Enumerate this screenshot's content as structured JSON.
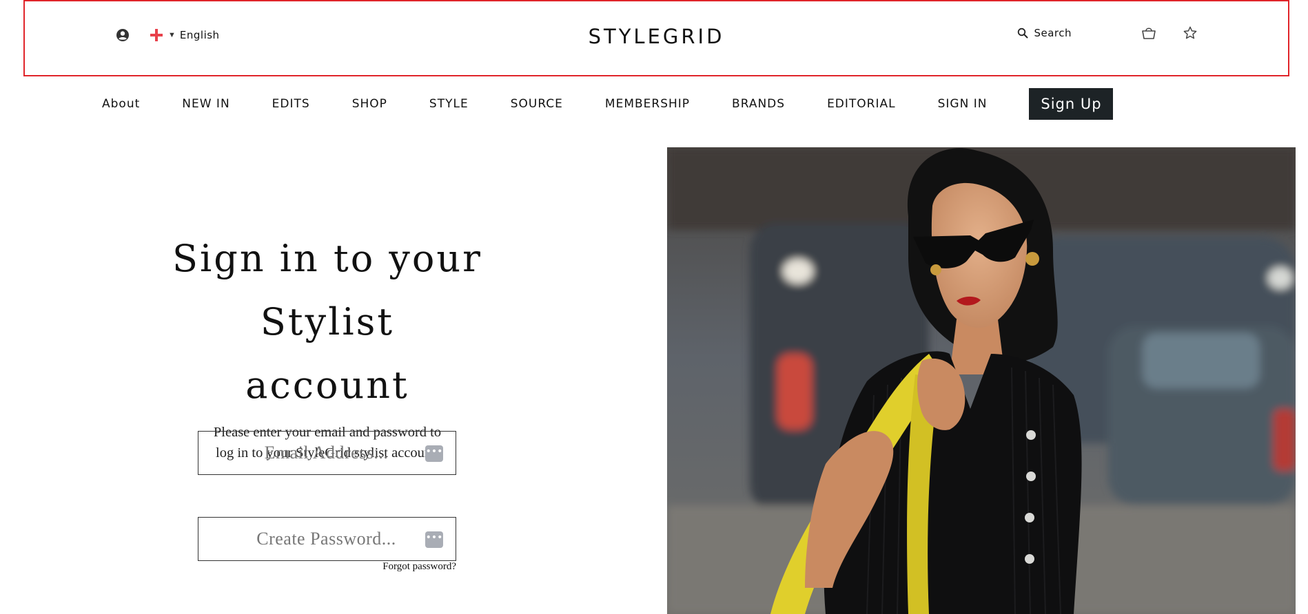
{
  "header": {
    "language": "English",
    "brand": "STYLEGRID",
    "search_label": "Search"
  },
  "nav": {
    "items": [
      "About",
      "NEW IN",
      "EDITS",
      "SHOP",
      "STYLE",
      "SOURCE",
      "MEMBERSHIP",
      "BRANDS",
      "EDITORIAL",
      "SIGN IN"
    ],
    "signup_label": "Sign Up"
  },
  "signin": {
    "title_line1": "Sign in to your",
    "title_line2": "Stylist account",
    "subtitle_line1": "Please enter your email and password to",
    "subtitle_line2": "log in to your StyleGrid stylist account.",
    "email_placeholder": "Email Address...",
    "password_placeholder": "Create Password...",
    "forgot_label": "Forgot password?"
  },
  "colors": {
    "header_outline": "#e0242a",
    "signup_bg": "#1d2326",
    "flag_red": "#e8414b",
    "pwd_icon": "#a9adb5"
  },
  "icons": {
    "account": "account-circle-icon",
    "flag": "georgia-flag-icon",
    "search": "search-icon",
    "basket": "basket-icon",
    "wishlist": "star-icon",
    "password_manager": "password-manager-icon"
  }
}
